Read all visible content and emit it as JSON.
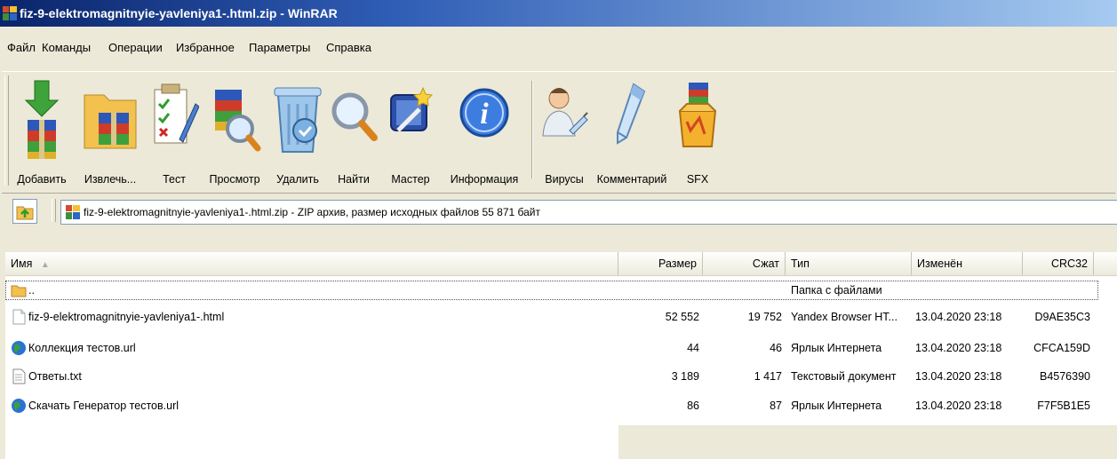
{
  "window": {
    "title": "fiz-9-elektromagnitnyie-yavleniya1-.html.zip - WinRAR"
  },
  "menu": [
    "Файл",
    "Команды",
    "Операции",
    "Избранное",
    "Параметры",
    "Справка"
  ],
  "toolbar": {
    "add": "Добавить",
    "extract": "Извлечь...",
    "test": "Тест",
    "view": "Просмотр",
    "delete": "Удалить",
    "find": "Найти",
    "wizard": "Мастер",
    "info": "Информация",
    "virus": "Вирусы",
    "comment": "Комментарий",
    "sfx": "SFX"
  },
  "address": {
    "text": "fiz-9-elektromagnitnyie-yavleniya1-.html.zip - ZIP архив, размер исходных файлов 55 871 байт"
  },
  "columns": {
    "name": "Имя",
    "size": "Размер",
    "packed": "Сжат",
    "type": "Тип",
    "modified": "Изменён",
    "crc": "CRC32"
  },
  "files": [
    {
      "icon": "folder-icon",
      "name": "..",
      "size": "",
      "packed": "",
      "type": "Папка с файлами",
      "modified": "",
      "crc": ""
    },
    {
      "icon": "html-file-icon",
      "name": "fiz-9-elektromagnitnyie-yavleniya1-.html",
      "size": "52 552",
      "packed": "19 752",
      "type": "Yandex Browser HT...",
      "modified": "13.04.2020 23:18",
      "crc": "D9AE35C3"
    },
    {
      "icon": "internet-shortcut-icon",
      "name": "Коллекция тестов.url",
      "size": "44",
      "packed": "46",
      "type": "Ярлык Интернета",
      "modified": "13.04.2020 23:18",
      "crc": "CFCA159D"
    },
    {
      "icon": "text-file-icon",
      "name": "Ответы.txt",
      "size": "3 189",
      "packed": "1 417",
      "type": "Текстовый документ",
      "modified": "13.04.2020 23:18",
      "crc": "B4576390"
    },
    {
      "icon": "internet-shortcut-icon",
      "name": "Скачать Генератор тестов.url",
      "size": "86",
      "packed": "87",
      "type": "Ярлык Интернета",
      "modified": "13.04.2020 23:18",
      "crc": "F7F5B1E5"
    }
  ]
}
